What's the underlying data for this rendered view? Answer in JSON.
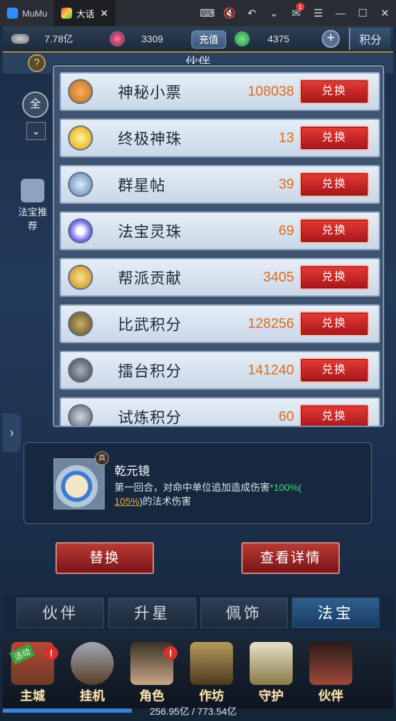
{
  "titlebar": {
    "tabs": [
      {
        "label": "MuMu"
      },
      {
        "label": "大话"
      }
    ],
    "notification_count": "1"
  },
  "resources": {
    "silver": "7.78亿",
    "gems": "3309",
    "recharge_label": "充值",
    "jade": "4375",
    "points_tab": "积分"
  },
  "background": {
    "header": "伙伴",
    "help": "?",
    "all_label": "全",
    "recommend_label": "法宝推荐"
  },
  "exchange": {
    "button_label": "兑换",
    "items": [
      {
        "name": "神秘小票",
        "qty": "108038",
        "icon": "ticket-icon"
      },
      {
        "name": "终极神珠",
        "qty": "13",
        "icon": "pearl-icon"
      },
      {
        "name": "群星帖",
        "qty": "39",
        "icon": "star-card-icon"
      },
      {
        "name": "法宝灵珠",
        "qty": "69",
        "icon": "spirit-orb-icon"
      },
      {
        "name": "帮派贡献",
        "qty": "3405",
        "icon": "guild-coin-icon"
      },
      {
        "name": "比武积分",
        "qty": "128256",
        "icon": "duel-coin-icon"
      },
      {
        "name": "擂台积分",
        "qty": "141240",
        "icon": "arena-coin-icon"
      },
      {
        "name": "试炼积分",
        "qty": "60",
        "icon": "trial-coin-icon"
      }
    ]
  },
  "fabao": {
    "name": "乾元镜",
    "seal": "真",
    "desc_prefix": "第一回合，对命中单位追加造成伤害",
    "desc_green": "*100%",
    "desc_open": "(",
    "desc_underline": "105%",
    "desc_suffix": ")的法术伤害"
  },
  "actions": {
    "replace": "替换",
    "details": "查看详情"
  },
  "tabs": [
    "伙伴",
    "升星",
    "佩饰",
    "法宝"
  ],
  "menu": {
    "activity_badge": "活动",
    "items": [
      {
        "label": "主城",
        "alert": "!"
      },
      {
        "label": "挂机",
        "alert": ""
      },
      {
        "label": "角色",
        "alert": "!"
      },
      {
        "label": "作坊",
        "alert": ""
      },
      {
        "label": "守护",
        "alert": ""
      },
      {
        "label": "伙伴",
        "alert": ""
      }
    ]
  },
  "exp_text": "256.95亿 / 773.54亿",
  "colors": {
    "accent_orange": "#e06a18",
    "button_red": "#c9252a",
    "highlight_green": "#38e06a"
  }
}
